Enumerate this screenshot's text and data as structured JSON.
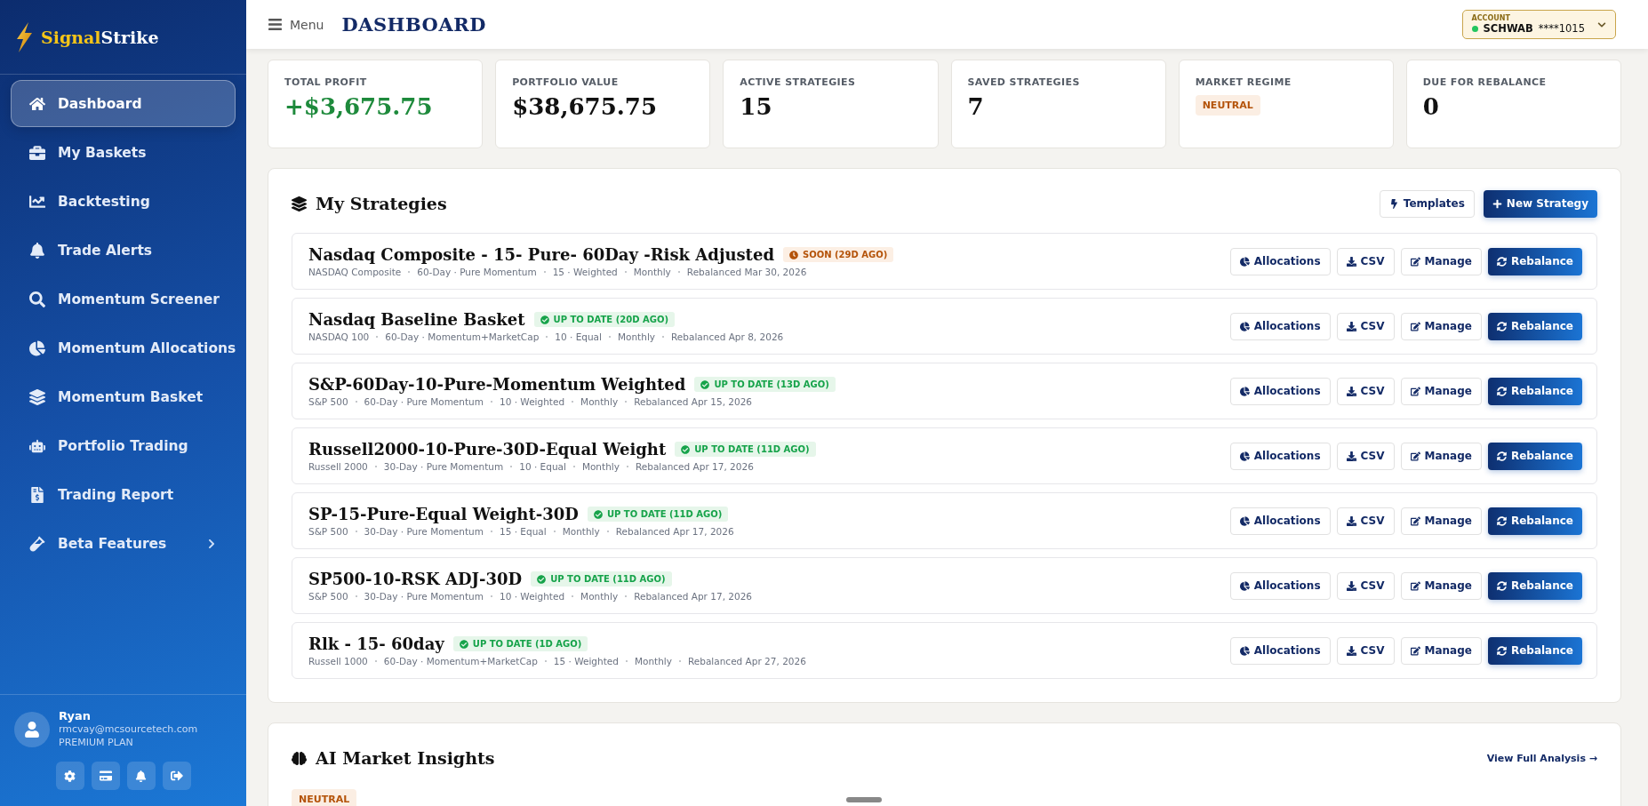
{
  "brand": {
    "first": "Signal",
    "second": "Strike"
  },
  "sidebar": {
    "items": [
      {
        "label": "Dashboard",
        "selected": true
      },
      {
        "label": "My Baskets",
        "selected": false
      },
      {
        "label": "Backtesting",
        "selected": false
      },
      {
        "label": "Trade Alerts",
        "selected": false
      },
      {
        "label": "Momentum Screener",
        "selected": false
      },
      {
        "label": "Momentum Allocations",
        "selected": false
      },
      {
        "label": "Momentum Basket",
        "selected": false
      },
      {
        "label": "Portfolio Trading",
        "selected": false
      },
      {
        "label": "Trading Report",
        "selected": false
      },
      {
        "label": "Beta Features",
        "selected": false,
        "expanded": false
      }
    ],
    "user": {
      "name": "Ryan",
      "email": "rmcvay@mcsourcetech.com",
      "plan": "PREMIUM PLAN"
    }
  },
  "header": {
    "menu_label": "Menu",
    "title": "DASHBOARD",
    "account": {
      "label": "ACCOUNT",
      "broker": "SCHWAB",
      "number": "****1015",
      "connected": true
    }
  },
  "stats": [
    {
      "label": "TOTAL PROFIT",
      "value": "+$3,675.75",
      "kind": "gain"
    },
    {
      "label": "PORTFOLIO VALUE",
      "value": "$38,675.75",
      "kind": "plain"
    },
    {
      "label": "ACTIVE STRATEGIES",
      "value": "15",
      "kind": "plain"
    },
    {
      "label": "SAVED STRATEGIES",
      "value": "7",
      "kind": "plain"
    },
    {
      "label": "MARKET REGIME",
      "value": "NEUTRAL",
      "kind": "badge"
    },
    {
      "label": "DUE FOR REBALANCE",
      "value": "0",
      "kind": "plain"
    }
  ],
  "strategies": {
    "title": "My Strategies",
    "templates_button": "Templates",
    "new_button": "New Strategy",
    "rows": [
      {
        "name": "Nasdaq Composite - 15- Pure- 60Day -Risk Adjusted",
        "status": {
          "label": "SOON (29D AGO)",
          "kind": "soon"
        },
        "meta": [
          "NASDAQ Composite",
          "60-Day · Pure Momentum",
          "15 · Weighted",
          "Monthly",
          "Rebalanced Mar 30, 2026"
        ],
        "actions": [
          "Allocations",
          "CSV",
          "Manage",
          "Rebalance"
        ]
      },
      {
        "name": "Nasdaq Baseline Basket",
        "status": {
          "label": "UP TO DATE (20D AGO)",
          "kind": "ok"
        },
        "meta": [
          "NASDAQ 100",
          "60-Day · Momentum+MarketCap",
          "10 · Equal",
          "Monthly",
          "Rebalanced Apr 8, 2026"
        ],
        "actions": [
          "Allocations",
          "CSV",
          "Manage",
          "Rebalance"
        ]
      },
      {
        "name": "S&P-60Day-10-Pure-Momentum Weighted",
        "status": {
          "label": "UP TO DATE (13D AGO)",
          "kind": "ok"
        },
        "meta": [
          "S&P 500",
          "60-Day · Pure Momentum",
          "10 · Weighted",
          "Monthly",
          "Rebalanced Apr 15, 2026"
        ],
        "actions": [
          "Allocations",
          "CSV",
          "Manage",
          "Rebalance"
        ]
      },
      {
        "name": "Russell2000-10-Pure-30D-Equal Weight",
        "status": {
          "label": "UP TO DATE (11D AGO)",
          "kind": "ok"
        },
        "meta": [
          "Russell 2000",
          "30-Day · Pure Momentum",
          "10 · Equal",
          "Monthly",
          "Rebalanced Apr 17, 2026"
        ],
        "actions": [
          "Allocations",
          "CSV",
          "Manage",
          "Rebalance"
        ]
      },
      {
        "name": "SP-15-Pure-Equal Weight-30D",
        "status": {
          "label": "UP TO DATE (11D AGO)",
          "kind": "ok"
        },
        "meta": [
          "S&P 500",
          "30-Day · Pure Momentum",
          "15 · Equal",
          "Monthly",
          "Rebalanced Apr 17, 2026"
        ],
        "actions": [
          "Allocations",
          "CSV",
          "Manage",
          "Rebalance"
        ]
      },
      {
        "name": "SP500-10-RSK ADJ-30D",
        "status": {
          "label": "UP TO DATE (11D AGO)",
          "kind": "ok"
        },
        "meta": [
          "S&P 500",
          "30-Day · Pure Momentum",
          "10 · Weighted",
          "Monthly",
          "Rebalanced Apr 17, 2026"
        ],
        "actions": [
          "Allocations",
          "CSV",
          "Manage",
          "Rebalance"
        ]
      },
      {
        "name": "Rlk - 15- 60day",
        "status": {
          "label": "UP TO DATE (1D AGO)",
          "kind": "ok"
        },
        "meta": [
          "Russell 1000",
          "60-Day · Momentum+MarketCap",
          "15 · Weighted",
          "Monthly",
          "Rebalanced Apr 27, 2026"
        ],
        "actions": [
          "Allocations",
          "CSV",
          "Manage",
          "Rebalance"
        ]
      }
    ]
  },
  "insights": {
    "title": "AI Market Insights",
    "link": "View Full Analysis →",
    "regime": "NEUTRAL"
  }
}
